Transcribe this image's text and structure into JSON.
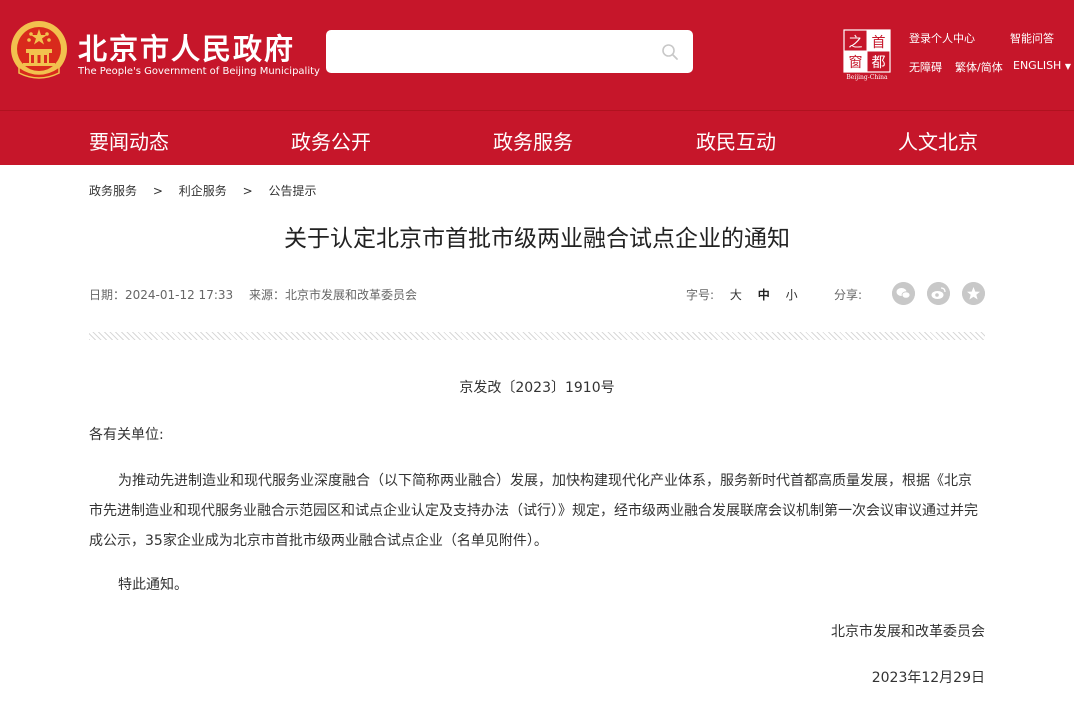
{
  "header": {
    "title_cn": "北京市人民政府",
    "title_en": "The People's Government of Beijing Municipality",
    "search_placeholder": "",
    "capital_logo_text": "首都之窗",
    "capital_logo_en": "Beijing-China",
    "links": {
      "login": "登录个人中心",
      "ai_qa": "智能问答",
      "accessibility": "无障碍",
      "trad_simp": "繁体/简体",
      "english": "ENGLISH"
    }
  },
  "nav": {
    "items": [
      {
        "label": "要闻动态"
      },
      {
        "label": "政务公开"
      },
      {
        "label": "政务服务"
      },
      {
        "label": "政民互动"
      },
      {
        "label": "人文北京"
      }
    ]
  },
  "breadcrumb": {
    "items": [
      "政务服务",
      "利企服务",
      "公告提示"
    ],
    "separator": ">"
  },
  "article": {
    "title": "关于认定北京市首批市级两业融合试点企业的通知",
    "date": "日期：2024-01-12 17:33",
    "source": "来源：北京市发展和改革委员会",
    "font_size_label": "字号:",
    "font_sizes": [
      "大",
      "中",
      "小"
    ],
    "share_label": "分享:",
    "share_icons": [
      "wechat-icon",
      "weibo-icon",
      "favorite-icon"
    ],
    "doc_no": "京发改〔2023〕1910号",
    "salutation": "各有关单位:",
    "body": "为推动先进制造业和现代服务业深度融合（以下简称两业融合）发展，加快构建现代化产业体系，服务新时代首都高质量发展，根据《北京市先进制造业和现代服务业融合示范园区和试点企业认定及支持办法（试行）》规定，经市级两业融合发展联席会议机制第一次会议审议通过并完成公示，35家企业成为北京市首批市级两业融合试点企业（名单见附件）。",
    "closing": "特此通知。",
    "signer": "北京市发展和改革委员会",
    "sign_date": "2023年12月29日"
  },
  "colors": {
    "brand_red": "#c6162a",
    "text": "#333333",
    "muted": "#666666"
  }
}
